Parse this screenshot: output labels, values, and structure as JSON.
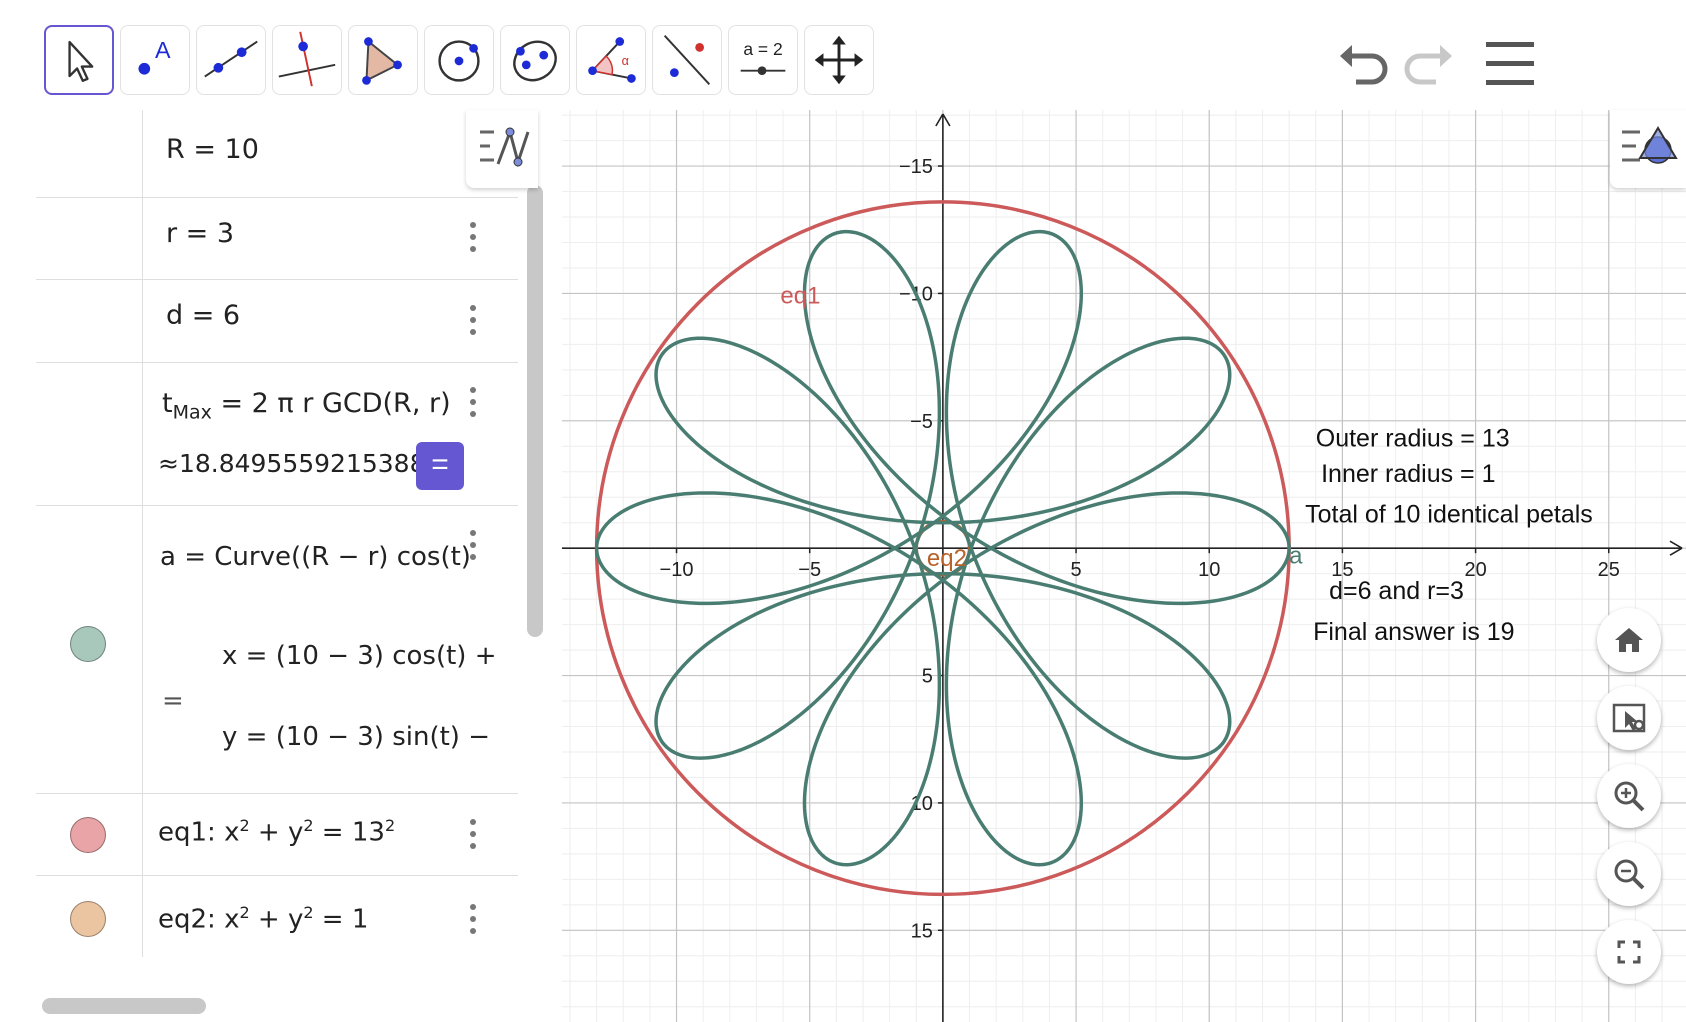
{
  "toolbar": {
    "tools": [
      {
        "name": "move-tool",
        "label": ""
      },
      {
        "name": "point-tool",
        "label": "A"
      },
      {
        "name": "line-tool",
        "label": ""
      },
      {
        "name": "perpendicular-tool",
        "label": ""
      },
      {
        "name": "polygon-tool",
        "label": ""
      },
      {
        "name": "circle-center-point-tool",
        "label": ""
      },
      {
        "name": "ellipse-tool",
        "label": ""
      },
      {
        "name": "angle-tool",
        "label": "α"
      },
      {
        "name": "reflect-tool",
        "label": ""
      },
      {
        "name": "slider-tool",
        "label": "a = 2"
      },
      {
        "name": "move-graphics-view-tool",
        "label": ""
      }
    ],
    "undo_icon": "undo-icon",
    "redo_icon": "redo-icon",
    "menu_icon": "menu-icon"
  },
  "algebra": {
    "rows": [
      {
        "id": "R",
        "text": "R = 10"
      },
      {
        "id": "r",
        "text": "r = 3"
      },
      {
        "id": "d",
        "text": "d = 6"
      },
      {
        "id": "tmax",
        "lhs": "t",
        "sub": "Max",
        "rhs": "= 2 π r GCD(R, r)",
        "value": "≈18.8495559215388",
        "eq_button": "="
      },
      {
        "id": "a",
        "def": "a = Curve((R − r)  cos(t)",
        "eq_sign": "=",
        "x": "x = (10 − 3)  cos(t) +",
        "y": "y = (10 − 3)  sin(t) −",
        "color": "#a8c8bc"
      },
      {
        "id": "eq1",
        "prefix": "eq1: x",
        "rest_a": " + y",
        "rest_b": " = 13",
        "sup": "2",
        "color": "#e8a4a6"
      },
      {
        "id": "eq2",
        "prefix": "eq2: x",
        "rest_a": " + y",
        "rest_b": " = 1",
        "sup": "2",
        "color": "#ebc4a2"
      }
    ]
  },
  "graphics": {
    "x_ticks": [
      "−10",
      "−5",
      "5",
      "10",
      "15",
      "20",
      "25"
    ],
    "y_ticks": [
      "15",
      "10",
      "5",
      "−5",
      "−10",
      "−15"
    ],
    "labels": {
      "eq1": "eq1",
      "eq2": "eq2",
      "a": "a"
    },
    "annotations": [
      "Outer radius = 13",
      "Inner radius = 1",
      "Total of 10 identical petals",
      "d=6 and r=3",
      "Final answer is 19"
    ],
    "colors": {
      "curve": "#4a7d72",
      "eq1": "#cc5a5a",
      "eq2": "#b8612a",
      "axis": "#222222"
    }
  },
  "chart_data": {
    "type": "line",
    "series": [
      {
        "name": "a",
        "kind": "hypotrochoid",
        "R": 10,
        "r": 3,
        "d": 6,
        "t_range": [
          0,
          18.8495559215388
        ]
      },
      {
        "name": "eq1",
        "kind": "circle",
        "radius": 13
      },
      {
        "name": "eq2",
        "kind": "circle",
        "radius": 1
      }
    ],
    "xlim": [
      -14.3,
      27.9
    ],
    "ylim": [
      -18.6,
      17.2
    ],
    "grid": true,
    "x_ticks": [
      -10,
      -5,
      5,
      10,
      15,
      20,
      25
    ],
    "y_ticks": [
      -15,
      -10,
      -5,
      5,
      10,
      15
    ]
  },
  "fabs": [
    "home-icon",
    "select-objects-icon",
    "zoom-in-icon",
    "zoom-out-icon",
    "fullscreen-icon"
  ]
}
